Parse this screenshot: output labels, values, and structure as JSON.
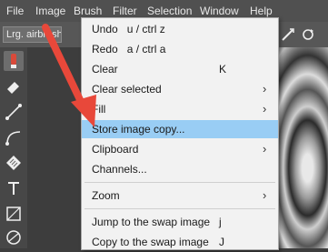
{
  "menubar": [
    "File",
    "Image",
    "Brush",
    "Filter",
    "Selection",
    "Window",
    "Help"
  ],
  "toolbar": {
    "brush_preset": "Lrg. airbrush",
    "icons": [
      "brush-direction-icon",
      "reset-icon"
    ]
  },
  "tools": [
    "airbrush-icon",
    "eraser-icon",
    "line-icon",
    "curve-icon",
    "fill-pattern-icon",
    "text-icon",
    "rectangle-icon",
    "ellipse-icon"
  ],
  "image_menu": {
    "items": [
      {
        "label": "Undo   u / ctrl z"
      },
      {
        "label": "Redo   a / ctrl a"
      },
      {
        "label": "Clear",
        "shortcut": "K"
      },
      {
        "label": "Clear selected",
        "submenu": true
      },
      {
        "label": "Fill",
        "submenu": true
      },
      {
        "label": "Store image copy...",
        "highlighted": true
      },
      {
        "label": "Clipboard",
        "submenu": true
      },
      {
        "label": "Channels..."
      },
      {
        "label": "Zoom",
        "submenu": true
      },
      {
        "label": "Jump to the swap image",
        "shortcut": "j"
      },
      {
        "label": "Copy to the swap image",
        "shortcut": "J"
      }
    ]
  },
  "annotation": {
    "arrow_color": "#e8483a"
  }
}
